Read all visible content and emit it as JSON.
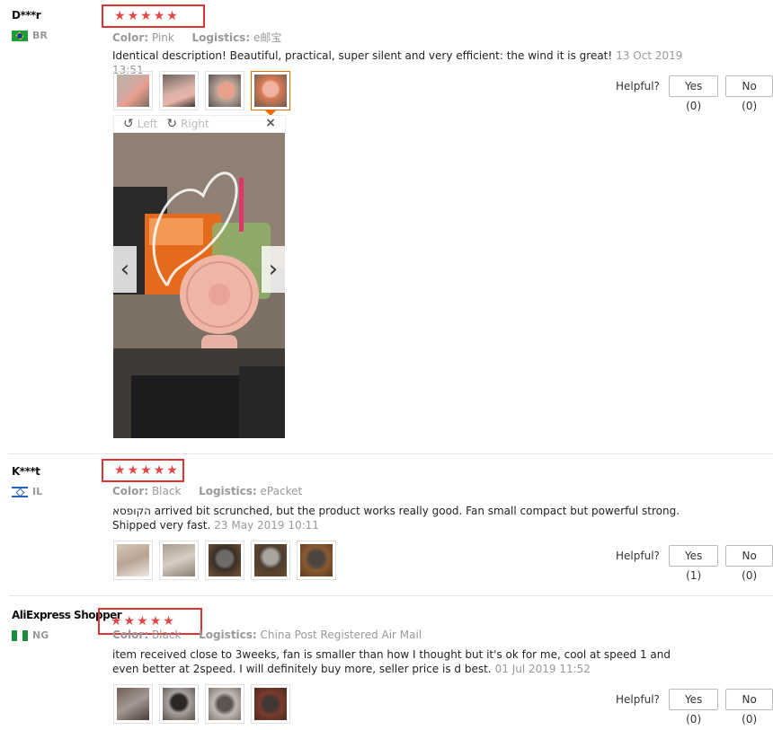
{
  "reviews": [
    {
      "user": "D***r",
      "country": "BR",
      "meta": {
        "color_label": "Color:",
        "color": "Pink",
        "logistics_label": "Logistics:",
        "logistics": "e邮宝"
      },
      "comment": "Identical description! Beautiful, practical, super silent and very efficient: the wind it is great!",
      "date": "13 Oct 2019 13:51",
      "helpful": {
        "label": "Helpful?",
        "yes": "Yes (0)",
        "no": "No (0)"
      }
    },
    {
      "user": "K***t",
      "country": "IL",
      "meta": {
        "color_label": "Color:",
        "color": "Black",
        "logistics_label": "Logistics:",
        "logistics": "ePacket"
      },
      "comment": "הקופסא arrived bit scrunched, but the product works really good. Fan small compact but powerful strong. Shipped very fast.",
      "date": "23 May 2019 10:11",
      "helpful": {
        "label": "Helpful?",
        "yes": "Yes (1)",
        "no": "No (0)"
      }
    },
    {
      "user": "AliExpress Shopper",
      "country": "NG",
      "meta": {
        "color_label": "Color:",
        "color": "Black",
        "logistics_label": "Logistics:",
        "logistics": "China Post Registered Air Mail"
      },
      "comment": "item received close to 3weeks, fan is smaller than how I thought but it's ok for me, cool at speed 1 and even better at 2speed. I will definitely buy more, seller price is d best.",
      "date": "01 Jul 2019 11:52",
      "helpful": {
        "label": "Helpful?",
        "yes": "Yes (0)",
        "no": "No (0)"
      }
    }
  ],
  "viewer": {
    "left": "Left",
    "right": "Right",
    "close": "×"
  },
  "stars": "★★★★★"
}
